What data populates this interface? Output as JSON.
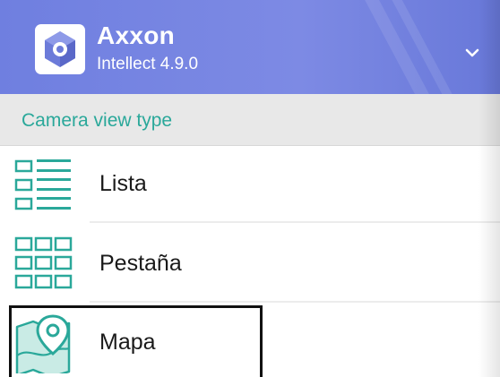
{
  "header": {
    "brand_name": "Axxon",
    "brand_version": "Intellect 4.9.0",
    "logo_icon": "axxon-cube-logo-icon",
    "expand_icon": "chevron-down-icon"
  },
  "section": {
    "label": "Camera view type"
  },
  "view_types": [
    {
      "label": "Lista",
      "icon": "list-icon"
    },
    {
      "label": "Pestaña",
      "icon": "grid-icon"
    },
    {
      "label": "Mapa",
      "icon": "map-pin-icon"
    }
  ],
  "colors": {
    "header_bg": "#7483e0",
    "accent_teal": "#2aa89a",
    "section_bg": "#e8e8e8",
    "highlight_border": "#111111"
  }
}
